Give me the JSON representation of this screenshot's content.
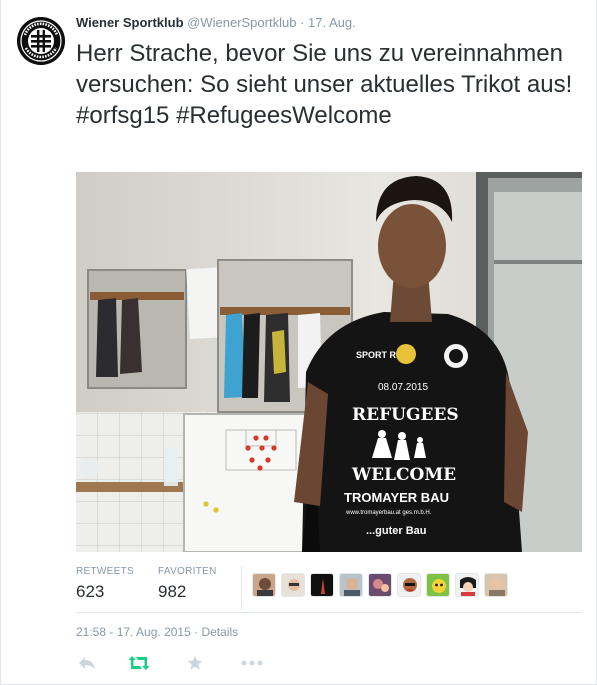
{
  "tweet": {
    "author_name": "Wiener Sportklub",
    "author_handle": "@WienerSportklub",
    "separator": "·",
    "date": "17. Aug.",
    "text_plain": "Herr Strache, bevor Sie uns zu vereinnahmen versuchen: So sieht unser aktuelles Trikot aus! ",
    "hashtag_1": "#orfsg15",
    "hashtag_2": "#RefugeesWelcome",
    "avatar_logo_text": "Wiener Sportklub"
  },
  "photo": {
    "shirt_sponsor": "SPORT RISS",
    "shirt_date": "08.07.2015",
    "shirt_line_1": "REFUGEES",
    "shirt_line_2": "WELCOME",
    "shirt_sponsor_2": "TROMAYER BAU",
    "shirt_sponsor_2_url": "www.tromayerbau.at  ges.m.b.H.",
    "shirt_slogan": "...guter Bau"
  },
  "stats": {
    "retweets_label": "RETWEETS",
    "retweets_value": "623",
    "favorites_label": "FAVORITEN",
    "favorites_value": "982"
  },
  "meta": {
    "timestamp": "21:58 - 17. Aug. 2015",
    "separator": "·",
    "details_link": "Details"
  },
  "actions": [
    "reply-icon",
    "retweet-icon",
    "favorite-icon",
    "more-icon"
  ],
  "colors": {
    "text": "#292f33",
    "muted": "#8899a6",
    "border": "#e1e8ed",
    "retweet_active": "#19cf86",
    "icon_idle": "#ccd6dd"
  }
}
